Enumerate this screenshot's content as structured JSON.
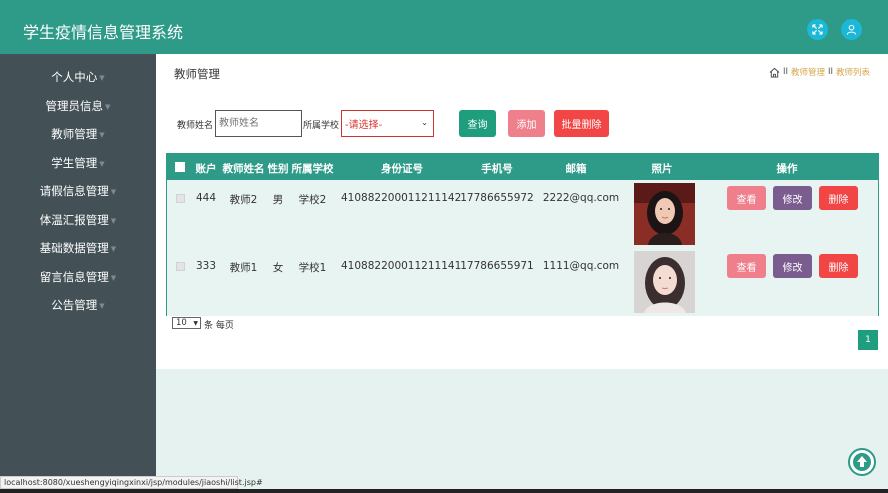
{
  "header": {
    "title": "学生疫情信息管理系统",
    "icons": [
      "fullscreen-icon",
      "user-icon"
    ],
    "bg_color": "#2e9a88"
  },
  "sidebar": {
    "items": [
      {
        "label": "个人中心"
      },
      {
        "label": "管理员信息"
      },
      {
        "label": "教师管理"
      },
      {
        "label": "学生管理"
      },
      {
        "label": "请假信息管理"
      },
      {
        "label": "体温汇报管理"
      },
      {
        "label": "基础数据管理"
      },
      {
        "label": "留言信息管理"
      },
      {
        "label": "公告管理"
      }
    ]
  },
  "page": {
    "title": "教师管理",
    "breadcrumb": [
      "教师管理",
      "教师列表"
    ],
    "breadcrumb_sep": "II"
  },
  "search": {
    "name_label": "教师姓名",
    "name_placeholder": "教师姓名",
    "school_label": "所属学校",
    "school_selected": "-请选择-",
    "query_button": "查询",
    "add_button": "添加",
    "batch_delete_button": "批量删除"
  },
  "table": {
    "columns": [
      "账户",
      "教师姓名",
      "性别",
      "所属学校",
      "身份证号",
      "手机号",
      "邮箱",
      "照片",
      "操作"
    ],
    "rows": [
      {
        "account": "444",
        "name": "教师2",
        "gender": "男",
        "school": "学校2",
        "id_card": "410882200011211142",
        "phone": "17786655972",
        "email": "2222@qq.com"
      },
      {
        "account": "333",
        "name": "教师1",
        "gender": "女",
        "school": "学校1",
        "id_card": "410882200011211141",
        "phone": "17786655971",
        "email": "1111@qq.com"
      }
    ],
    "actions": {
      "view": "查看",
      "edit": "修改",
      "delete": "删除"
    }
  },
  "pagination": {
    "page_size": "10",
    "per_page_text": "条 每页",
    "current_page": "1"
  },
  "status": {
    "url": "localhost:8080/xueshengyiqingxinxi/jsp/modules/jiaoshi/list.jsp#"
  },
  "colors": {
    "primary": "#2e9a88",
    "query": "#1f9e7e",
    "add": "#f07f8c",
    "batch_delete": "#f24646",
    "view": "#f07f8c",
    "edit": "#7b5c8e",
    "delete": "#f24646"
  }
}
